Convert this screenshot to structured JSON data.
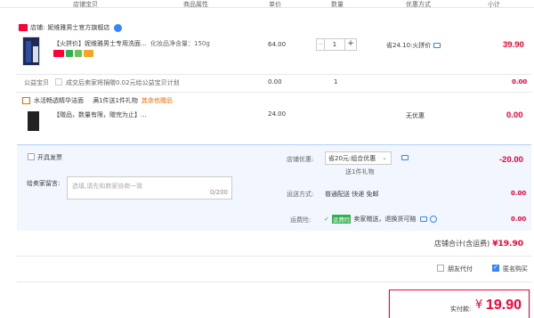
{
  "columns": [
    "店铺宝贝",
    "商品属性",
    "单价",
    "数量",
    "优惠方式",
    "小计"
  ],
  "shop": {
    "prefix": "店铺:",
    "name": "妮维雅男士官方旗舰店"
  },
  "item": {
    "title": "【火拼价】妮维雅男士专用洗面...",
    "attr": "化妆品净含量：150g",
    "price": "64.00",
    "qty": "1",
    "qty_minus": "—",
    "qty_plus": "+",
    "discount": "省24.10:火拼价",
    "subtotal": "39.90"
  },
  "charity": {
    "label": "公益宝贝",
    "text": "成交后卖家将捐赠0.02元给公益宝贝计划",
    "price": "0.00",
    "qty": "1",
    "subtotal": "0.00"
  },
  "gift_header": {
    "title": "水活畅透精华洁面",
    "rule": "满1件送1件礼物",
    "link": "其余也赠品"
  },
  "gift": {
    "title": "【赠品，数量有限，赠完为止】...",
    "price": "24.00",
    "discount": "无优惠",
    "subtotal": "0.00"
  },
  "invoice": {
    "label": "开具发票"
  },
  "shop_discount": {
    "label": "店铺优惠:",
    "value": "省20元:组合优惠",
    "sub": "送1件礼物",
    "amount": "-20.00"
  },
  "message": {
    "label": "给卖家留言:",
    "placeholder": "选填,请先和商家协商一致",
    "counter": "0/200"
  },
  "shipping": {
    "label": "运送方式:",
    "value": "普通配送 快递 免邮",
    "amount": "0.00"
  },
  "insurance": {
    "label": "运费险:",
    "badge": "运费险",
    "text": "卖家赠送，退换货可赔",
    "amount": "0.00"
  },
  "shop_total": {
    "label": "店铺合计(含运费)",
    "amount": "¥19.90"
  },
  "options": {
    "friend_pay": "朋友代付",
    "anonymous": "匿名购买"
  },
  "footer": {
    "label": "实付款:",
    "currency": "¥",
    "amount": "19.90"
  },
  "colors": {
    "accent": "#ff0036",
    "link_blue": "#3388ff",
    "panel_bg": "#f2f7ff",
    "panel_border": "#b2d1ff"
  }
}
